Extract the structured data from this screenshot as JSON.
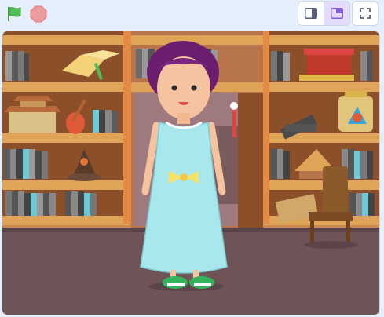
{
  "controls": {
    "green_flag_icon": "green-flag-icon",
    "stop_icon": "stop-icon"
  },
  "view_modes": [
    {
      "name": "small-stage-layout",
      "active": false
    },
    {
      "name": "normal-stage-layout",
      "active": true
    }
  ],
  "fullscreen_icon": "fullscreen-icon",
  "colors": {
    "accent": "#855cd6",
    "flag": "#4cbf56",
    "stop": "#ec9c9c",
    "toolbar_bg": "#e6f0fd",
    "shelf": "#d48a3e",
    "wall": "#c9894f"
  },
  "stage": {
    "backdrop": "library",
    "sprite": "girl-in-blue-dress"
  }
}
